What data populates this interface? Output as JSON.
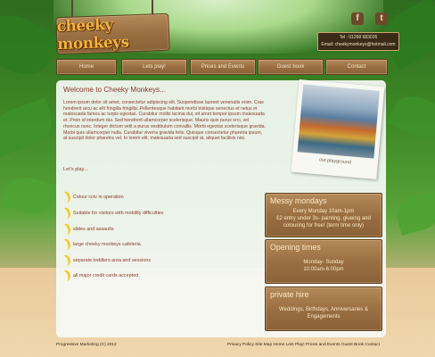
{
  "header": {
    "logo_text": "cheeky monkeys",
    "contact_phone": "Tel : 01268 683026",
    "contact_email": "Email: cheekymonkeys@hotmail.com",
    "social_icons": [
      "facebook-icon",
      "twitter-icon"
    ]
  },
  "nav": {
    "items": [
      {
        "label": "Home"
      },
      {
        "label": "Lets play!"
      },
      {
        "label": "Prices and Events"
      },
      {
        "label": "Guest book"
      },
      {
        "label": "Contact"
      }
    ]
  },
  "main": {
    "title": "Welcome to Cheeky Monkeys...",
    "intro": "Lorem ipsum dolor sit amet, consectetur adipiscing elit. Suspendisse laoreet venenatis enim. Cras hendrerit arcu ac elit fringilla fringilla. Pellentesque habitant morbi tristique senectus et netus et malesuada fames ac turpis egestas. Curabitur mollis lacinia dui, sit amet tempor ipsum malesuada et. Proin id interdum dui. Sed hendrerit ullamcorper scelerisque. Mauris quis purus orci, vel rhoncus nunc. Integer dictum velit a purus vestibulum convallis. Morbi egestas scelerisque gravida. Morbi quis ullamcorper nulla. Curabitur viverra gravida felis. Quisque consectetur pharetra ipsum, at suscipit dolor pharetra vel. In lorem elit, malesuada sed suscipit at, aliquet facilisis nisi.",
    "lets_play": "Let's play...",
    "features": [
      "Colour cctv in operation",
      "Suitable for visitors with mobility difficulties",
      "slides and assaults",
      "large cheeky monkeys cafeteria",
      "separate toddlers area and sessions",
      "all major credit cards accepted"
    ],
    "photo_caption": "our playground"
  },
  "boards": [
    {
      "title": "Messy mondays",
      "lines": [
        "Every Monday 10am-1pm",
        "£2 entry under 3s- painting, glueing and colouring for free! (term time only)"
      ]
    },
    {
      "title": "Opening times",
      "lines": [
        "Monday- Sunday",
        "10:00am-6:00pm"
      ]
    },
    {
      "title": "private hire",
      "lines": [
        "Weddings, Birthdays, Anniversaries &",
        "Engagements"
      ]
    }
  ],
  "footer": {
    "copyright": "Progressive Marketing (C) 2012",
    "links": "Privacy Policy  Site Map  Home  Lets Play!  Prices and Events  Guest Book  Contact"
  },
  "colors": {
    "text_brown": "#8c3a2c",
    "plank": "#9a6f42",
    "banana": "#f3cc2b"
  }
}
